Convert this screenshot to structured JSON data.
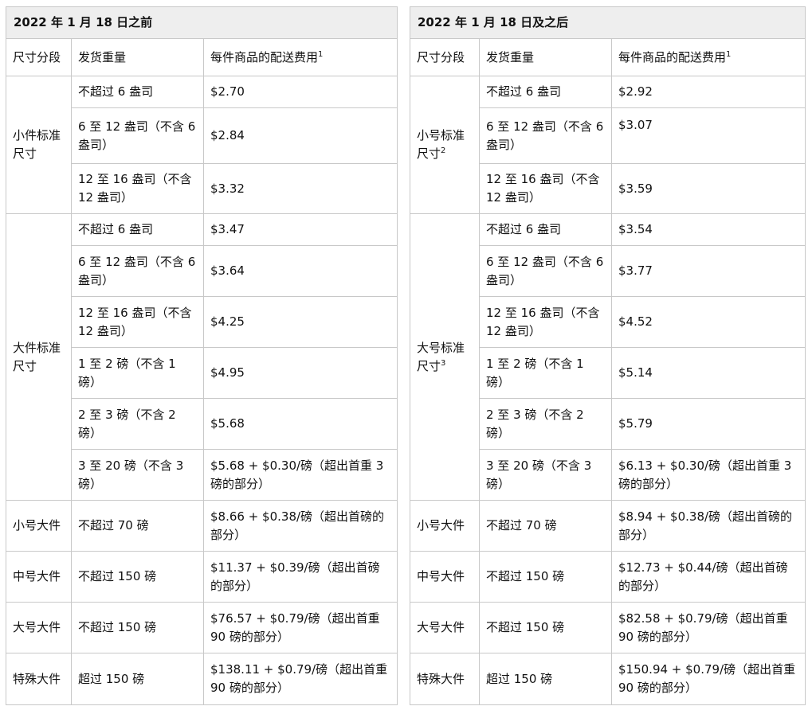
{
  "tables": [
    {
      "title": "2022 年 1 月 18 日之前",
      "headers": {
        "tier": "尺寸分段",
        "weight": "发货重量",
        "fee": "每件商品的配送费用",
        "fee_sup": "1"
      },
      "groups": {
        "small_standard": {
          "label": "小件标准尺寸",
          "sup": ""
        },
        "large_standard": {
          "label": "大件标准尺寸",
          "sup": ""
        }
      },
      "rows": [
        {
          "weight": "不超过 6 盎司",
          "fee": "$2.70"
        },
        {
          "weight": "6 至 12 盎司（不含 6 盎司）",
          "fee": "$2.84"
        },
        {
          "weight": "12 至 16 盎司（不含 12 盎司）",
          "fee": "$3.32"
        },
        {
          "weight": "不超过 6 盎司",
          "fee": "$3.47"
        },
        {
          "weight": "6 至 12 盎司（不含 6 盎司）",
          "fee": "$3.64"
        },
        {
          "weight": "12 至 16 盎司（不含 12 盎司）",
          "fee": "$4.25"
        },
        {
          "weight": "1 至 2 磅（不含 1 磅）",
          "fee": "$4.95"
        },
        {
          "weight": "2 至 3 磅（不含 2 磅）",
          "fee": "$5.68"
        },
        {
          "weight": "3 至 20 磅（不含 3 磅）",
          "fee": "$5.68 + $0.30/磅（超出首重 3 磅的部分）"
        },
        {
          "tier": "小号大件",
          "weight": "不超过 70 磅",
          "fee": "$8.66 + $0.38/磅（超出首磅的部分）"
        },
        {
          "tier": "中号大件",
          "weight": "不超过 150 磅",
          "fee": "$11.37 + $0.39/磅（超出首磅的部分）"
        },
        {
          "tier": "大号大件",
          "weight": "不超过 150 磅",
          "fee": "$76.57 + $0.79/磅（超出首重 90 磅的部分）"
        },
        {
          "tier": "特殊大件",
          "weight": "超过 150 磅",
          "fee": "$138.11 + $0.79/磅（超出首重 90 磅的部分）"
        }
      ]
    },
    {
      "title": "2022 年 1 月 18 日及之后",
      "headers": {
        "tier": "尺寸分段",
        "weight": "发货重量",
        "fee": "每件商品的配送费用",
        "fee_sup": "1"
      },
      "groups": {
        "small_standard": {
          "label": "小号标准尺寸",
          "sup": "2"
        },
        "large_standard": {
          "label": "大号标准尺寸",
          "sup": "3"
        }
      },
      "rows": [
        {
          "weight": "不超过 6 盎司",
          "fee": "$2.92"
        },
        {
          "weight": "6 至 12 盎司（不含 6 盎司）",
          "fee": "$3.07"
        },
        {
          "weight": "12 至 16 盎司（不含 12 盎司）",
          "fee": "$3.59"
        },
        {
          "weight": "不超过 6 盎司",
          "fee": "$3.54"
        },
        {
          "weight": "6 至 12 盎司（不含 6 盎司）",
          "fee": "$3.77"
        },
        {
          "weight": "12 至 16 盎司（不含 12 盎司）",
          "fee": "$4.52"
        },
        {
          "weight": "1 至 2 磅（不含 1 磅）",
          "fee": "$5.14"
        },
        {
          "weight": "2 至 3 磅（不含 2 磅）",
          "fee": "$5.79"
        },
        {
          "weight": "3 至 20 磅（不含 3 磅）",
          "fee": "$6.13 + $0.30/磅（超出首重 3 磅的部分）"
        },
        {
          "tier": "小号大件",
          "weight": "不超过 70 磅",
          "fee": "$8.94 + $0.38/磅（超出首磅的部分）"
        },
        {
          "tier": "中号大件",
          "weight": "不超过 150 磅",
          "fee": "$12.73 + $0.44/磅（超出首磅的部分）"
        },
        {
          "tier": "大号大件",
          "weight": "不超过 150 磅",
          "fee": "$82.58 + $0.79/磅（超出首重 90 磅的部分）"
        },
        {
          "tier": "特殊大件",
          "weight": "超过 150 磅",
          "fee": "$150.94 + $0.79/磅（超出首重 90 磅的部分）"
        }
      ]
    }
  ]
}
